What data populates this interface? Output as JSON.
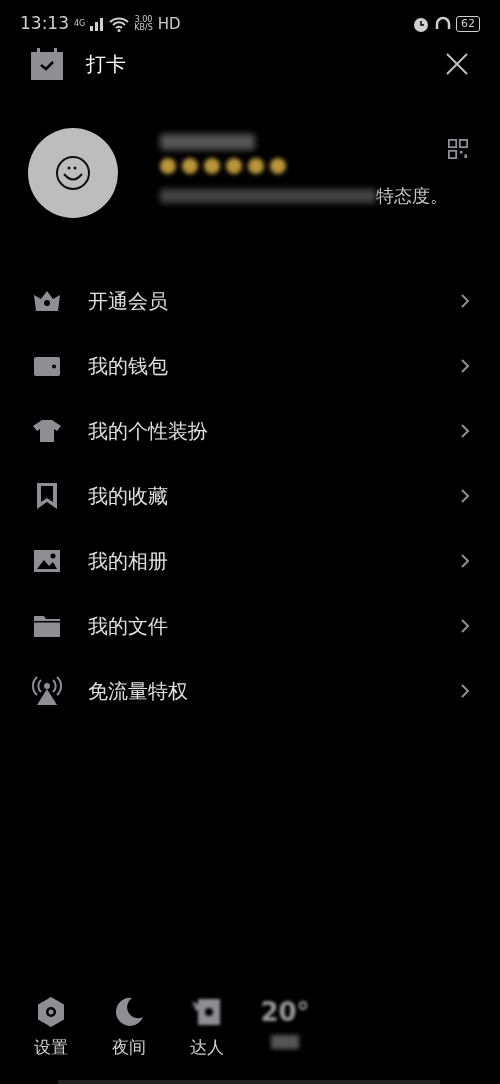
{
  "status_bar": {
    "time": "13:13",
    "network": "4G",
    "speed_value": "3.00",
    "speed_unit": "KB/S",
    "hd": "HD",
    "battery": "62"
  },
  "header": {
    "title": "打卡"
  },
  "profile": {
    "signature_visible": "特态度。"
  },
  "menu": [
    {
      "label": "开通会员"
    },
    {
      "label": "我的钱包"
    },
    {
      "label": "我的个性装扮"
    },
    {
      "label": "我的收藏"
    },
    {
      "label": "我的相册"
    },
    {
      "label": "我的文件"
    },
    {
      "label": "免流量特权"
    }
  ],
  "bottom_bar": [
    {
      "label": "设置",
      "kind": "shortcut"
    },
    {
      "label": "夜间",
      "kind": "shortcut"
    },
    {
      "label": "达人",
      "kind": "shortcut"
    },
    {
      "label": "20°",
      "kind": "weather"
    }
  ]
}
